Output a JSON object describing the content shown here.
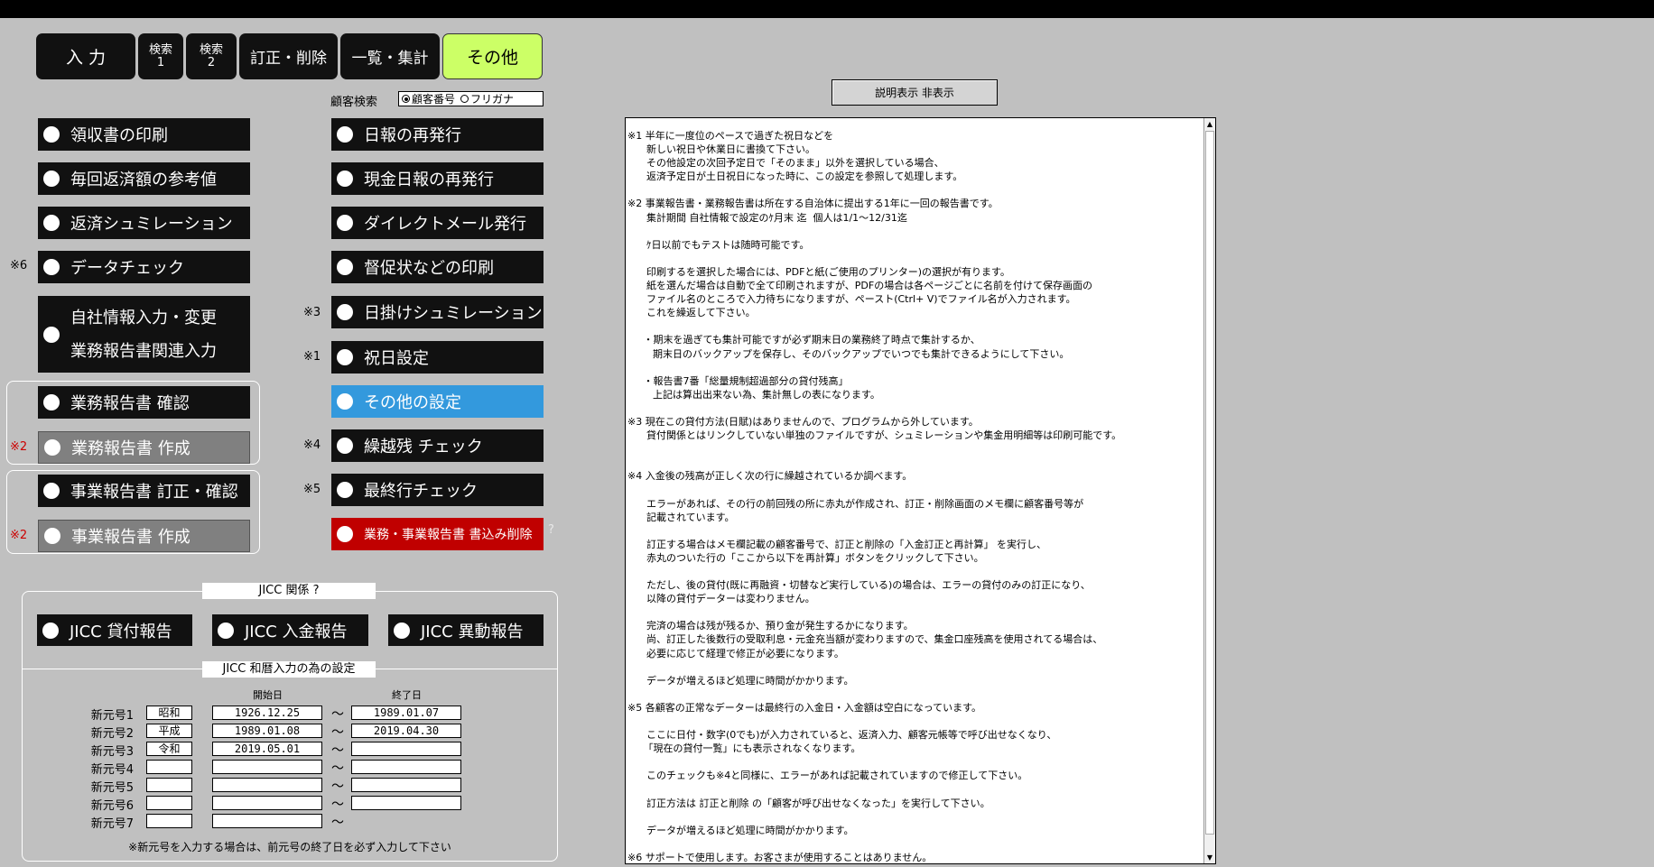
{
  "tabs": [
    {
      "label": "入 力"
    },
    {
      "label": "検索\n1"
    },
    {
      "label": "検索\n2"
    },
    {
      "label": "訂正・削除"
    },
    {
      "label": "一覧・集計"
    },
    {
      "label": "その他"
    }
  ],
  "customer_search": {
    "label": "顧客検索",
    "options": [
      "顧客番号",
      "フリガナ"
    ],
    "selected": "顧客番号"
  },
  "left_menu": {
    "receipt": "領収書の印刷",
    "repay_ref": "毎回返済額の参考値",
    "repay_sim": "返済シュミレーション",
    "data_check": "データチェック",
    "data_check_note": "※6",
    "company_info_1": "自社情報入力・変更",
    "company_info_2": "業務報告書関連入力",
    "biz_report_confirm": "業務報告書 確認",
    "biz_report_create": "業務報告書 作成",
    "biz_report_create_note": "※2",
    "jigyo_report_fix": "事業報告書 訂正・確認",
    "jigyo_report_create": "事業報告書 作成",
    "jigyo_report_create_note": "※2"
  },
  "right_menu": {
    "daily_reissue": "日報の再発行",
    "cash_daily_reissue": "現金日報の再発行",
    "direct_mail": "ダイレクトメール発行",
    "dun_print": "督促状などの印刷",
    "daily_sim": "日掛けシュミレーション",
    "daily_sim_note": "※3",
    "holiday": "祝日設定",
    "holiday_note": "※1",
    "other_settings": "その他の設定",
    "carryover_check": "繰越残 チェック",
    "carryover_note": "※4",
    "last_row_check": "最終行チェック",
    "last_row_note": "※5",
    "report_delete": "業務・事業報告書 書込み削除",
    "help_mark": "?"
  },
  "jicc": {
    "title": "JICC 関係 ?",
    "loan_report": "JICC 貸付報告",
    "payment_report": "JICC 入金報告",
    "change_report": "JICC 異動報告",
    "era_title": "JICC 和暦入力の為の設定",
    "start_header": "開始日",
    "end_header": "終了日",
    "tilde": "～",
    "eras": [
      {
        "label": "新元号1",
        "name": "昭和",
        "start": "1926.12.25",
        "end": "1989.01.07"
      },
      {
        "label": "新元号2",
        "name": "平成",
        "start": "1989.01.08",
        "end": "2019.04.30"
      },
      {
        "label": "新元号3",
        "name": "令和",
        "start": "2019.05.01",
        "end": ""
      },
      {
        "label": "新元号4",
        "name": "",
        "start": "",
        "end": ""
      },
      {
        "label": "新元号5",
        "name": "",
        "start": "",
        "end": ""
      },
      {
        "label": "新元号6",
        "name": "",
        "start": "",
        "end": ""
      },
      {
        "label": "新元号7",
        "name": "",
        "start": "",
        "end": ""
      }
    ],
    "footer_note": "※新元号を入力する場合は、前元号の終了日を必ず入力して下さい"
  },
  "description": {
    "toggle_label": "説明表示 非表示",
    "text": "※1 半年に一度位のペースで過ぎた祝日などを\n      新しい祝日や休業日に書換て下さい。\n      その他設定の次回予定日で「そのまま」以外を選択している場合、\n      返済予定日が土日祝日になった時に、この設定を参照して処理します。\n\n※2 事業報告書・業務報告書は所在する自治体に提出する1年に一回の報告書です。\n      集計期間 自社情報で設定のｹ月末 迄  個人は1/1～12/31迄\n\n      ｹ日以前でもテストは随時可能です。\n\n      印刷するを選択した場合には、PDFと紙(ご使用のプリンター)の選択が有ります。\n      紙を選んだ場合は自動で全て印刷されますが、PDFの場合は各ページごとに名前を付けて保存画面の\n      ファイル名のところで入力待ちになりますが、ペースト(Ctrl+ V)でファイル名が入力されます。\n      これを繰返して下さい。\n\n     ・期末を過ぎても集計可能ですが必ず期末日の業務終了時点で集計するか、\n        期末日のバックアップを保存し、そのバックアップでいつでも集計できるようにして下さい。\n\n     ・報告書7番「総量規制超過部分の貸付残高」\n        上記は算出出来ない為、集計無しの表になります。\n\n※3 現在この貸付方法(日賦)はありませんので、プログラムから外しています。\n      貸付関係とはリンクしていない単独のファイルですが、シュミレーションや集金用明細等は印刷可能です。\n\n\n※4 入金後の残高が正しく次の行に繰越されているか調べます。\n\n      エラーがあれば、その行の前回残の所に赤丸が作成され、訂正・削除画面のメモ欄に顧客番号等が\n      記載されています。\n\n      訂正する場合はメモ欄記載の顧客番号で、訂正と削除の「入金訂正と再計算」 を実行し、\n      赤丸のついた行の「ここから以下を再計算」ボタンをクリックして下さい。\n\n      ただし、後の貸付(既に再融資・切替など実行している)の場合は、エラーの貸付のみの訂正になり、\n      以降の貸付データーは変わりません。\n\n      完済の場合は残が残るか、預り金が発生するかになります。\n      尚、訂正した後数行の受取利息・元金充当額が変わりますので、集金口座残高を使用されてる場合は、\n      必要に応じて経理で修正が必要になります。\n\n      データが増えるほど処理に時間がかかります。\n\n※5 各顧客の正常なデーターは最終行の入金日・入金額は空白になっています。\n\n      ここに日付・数字(0でも)が入力されていると、返済入力、顧客元帳等で呼び出せなくなり、\n     「現在の貸付一覧」にも表示されなくなります。\n\n      このチェックも※4と同様に、エラーがあれば記載されていますので修正して下さい。\n\n      訂正方法は 訂正と削除 の「顧客が呼び出せなくなった」を実行して下さい。\n\n      データが増えるほど処理に時間がかかります。\n\n※6 サポートで使用します。お客さまが使用することはありません。"
  }
}
